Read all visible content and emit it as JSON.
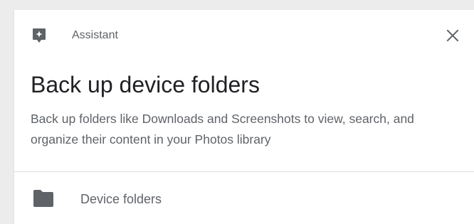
{
  "card": {
    "header_label": "Assistant",
    "title": "Back up device folders",
    "description": "Back up folders like Downloads and Screenshots to view, search, and organize their content in your Photos library",
    "folder_item_label": "Device folders"
  },
  "icons": {
    "assistant": "assistant-icon",
    "close": "close-icon",
    "folder": "folder-icon"
  },
  "colors": {
    "icon": "#5f6368",
    "title": "#202124",
    "text": "#5f6368",
    "divider": "#dadce0",
    "background": "#ececec"
  }
}
